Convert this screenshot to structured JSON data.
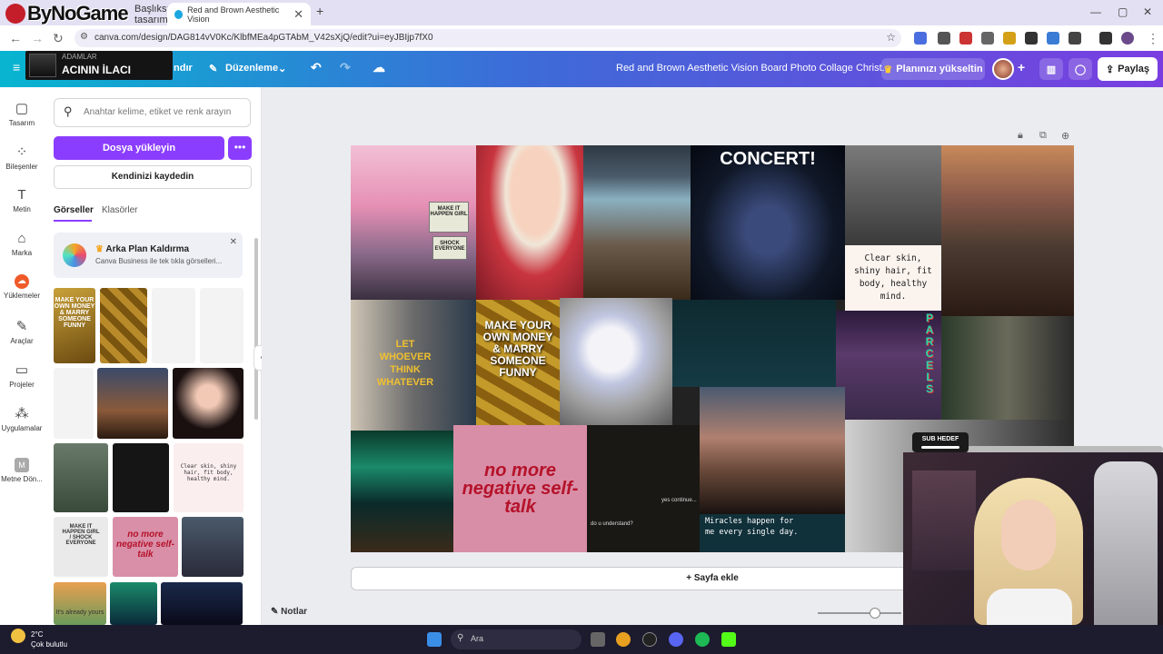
{
  "browser": {
    "tabs": [
      {
        "label": "Başlıksız tasarım"
      },
      {
        "label": "Red and Brown Aesthetic Vision"
      }
    ],
    "new_tab": "+",
    "url": "canva.com/design/DAG814vV0Kc/KlbfMEa4pGTAbM_V42sXjQ/edit?ui=eyJBIjp7fX0",
    "win_min": "—",
    "win_max": "▢",
    "win_close": "✕"
  },
  "overlay": {
    "logo": "ByNoGame",
    "tv_small": "ADAMLAR",
    "tv_title": "ACININ İLACI"
  },
  "canva": {
    "menu_resize": "ndır",
    "menu_edit": "Düzenleme",
    "title": "Red and Brown Aesthetic Vision Board Photo Collage Christ...",
    "upgrade": "Planınızı yükseltin",
    "share": "Paylaş"
  },
  "rail": [
    {
      "label": "Tasarım",
      "icon": "design-icon"
    },
    {
      "label": "Bileşenler",
      "icon": "elements-icon"
    },
    {
      "label": "Metin",
      "icon": "text-icon"
    },
    {
      "label": "Marka",
      "icon": "brand-icon"
    },
    {
      "label": "Yüklemeler",
      "icon": "uploads-icon"
    },
    {
      "label": "Araçlar",
      "icon": "tools-icon"
    },
    {
      "label": "Projeler",
      "icon": "projects-icon"
    },
    {
      "label": "Uygulamalar",
      "icon": "apps-icon"
    },
    {
      "label": "Metne Dön...",
      "icon": "text-convert-icon"
    }
  ],
  "panel": {
    "search_placeholder": "Anahtar kelime, etiket ve renk arayın",
    "upload": "Dosya yükleyin",
    "more": "•••",
    "record": "Kendinizi kaydedin",
    "tab_images": "Görseller",
    "tab_folders": "Klasörler",
    "promo_title": "Arka Plan Kaldırma",
    "promo_sub": "Canva Business ile tek tıkla görselleri...",
    "thumb_texts": {
      "money": "MAKE YOUR OWN MONEY & MARRY SOMEONE FUNNY",
      "clear": "Clear skin, shiny hair, fit body, healthy mind.",
      "sign": "MAKE IT HAPPEN GIRL / SHOCK EVERYONE",
      "neg": "no more negative self-talk",
      "bottom": "It's already yours"
    }
  },
  "collage": {
    "concert": "CONCERT!",
    "clear_skin": "Clear skin, shiny hair, fit body, healthy mind.",
    "sign_top": "MAKE IT HAPPEN GIRL",
    "sign_bottom": "SHOCK EVERYONE",
    "let_whoever": "LET WHOEVER THINK WHATEVER",
    "make_money": "MAKE YOUR OWN MONEY & MARRY SOMEONE FUNNY",
    "parcels": "PARCELS",
    "no_more": "no more negative self-talk",
    "understand": "do u understand?",
    "yes_continue": "yes continue...",
    "miracles": "Miracles happen for me every single day."
  },
  "canvas": {
    "add_page": "+ Sayfa ekle",
    "notes": "Notlar"
  },
  "stream": {
    "sub_goal": "SUB HEDEF"
  },
  "taskbar": {
    "temp": "2°C",
    "weather": "Çok bulutlu",
    "search": "Ara"
  }
}
